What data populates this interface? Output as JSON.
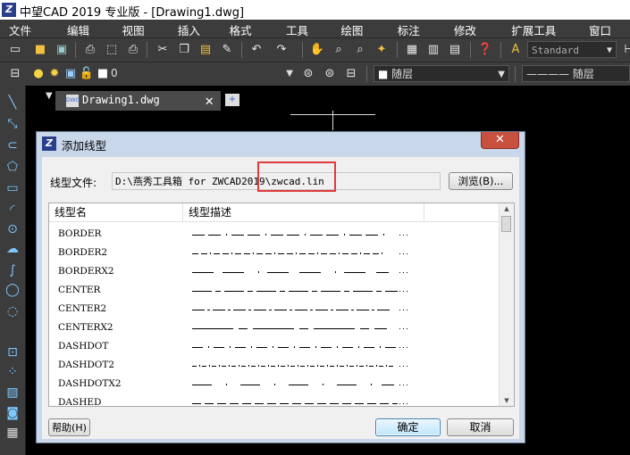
{
  "app": {
    "title": "中望CAD 2019 专业版 - [Drawing1.dwg]",
    "logo": "Z"
  },
  "menu": [
    "文件(F)",
    "编辑(E)",
    "视图(V)",
    "插入(I)",
    "格式(O)",
    "工具(T)",
    "绘图(D)",
    "标注(N)",
    "修改(M)",
    "扩展工具(X)",
    "窗口(W)"
  ],
  "toolbar": {
    "text_style": "Standard",
    "layer_value": "0",
    "color_value": "随层",
    "linetype_value": "随层"
  },
  "doc_tab": {
    "label": "Drawing1.dwg",
    "icon_text": "DWG"
  },
  "dialog": {
    "title": "添加线型",
    "file_label": "线型文件:",
    "file_path": "D:\\燕秀工具箱 for ZWCAD2019\\zwcad.lin",
    "browse_label": "浏览(B)...",
    "columns": [
      "线型名",
      "线型描述"
    ],
    "rows": [
      {
        "name": "BORDER",
        "pattern": "dash-dash-dot"
      },
      {
        "name": "BORDER2",
        "pattern": "dash-dash-dot-small"
      },
      {
        "name": "BORDERX2",
        "pattern": "dash-dash-dot-large"
      },
      {
        "name": "CENTER",
        "pattern": "long-short"
      },
      {
        "name": "CENTER2",
        "pattern": "long-short-small"
      },
      {
        "name": "CENTERX2",
        "pattern": "long-short-large"
      },
      {
        "name": "DASHDOT",
        "pattern": "dash-dot"
      },
      {
        "name": "DASHDOT2",
        "pattern": "dash-dot-small"
      },
      {
        "name": "DASHDOTX2",
        "pattern": "dash-dot-large"
      },
      {
        "name": "DASHED",
        "pattern": "dashed"
      }
    ],
    "help_label": "帮助(H)",
    "ok_label": "确定",
    "cancel_label": "取消"
  },
  "colors": {
    "highlight_box": "#e03a3a",
    "ui_dark": "#3c3c3c",
    "dialog_frame": "#c9d7ea"
  }
}
